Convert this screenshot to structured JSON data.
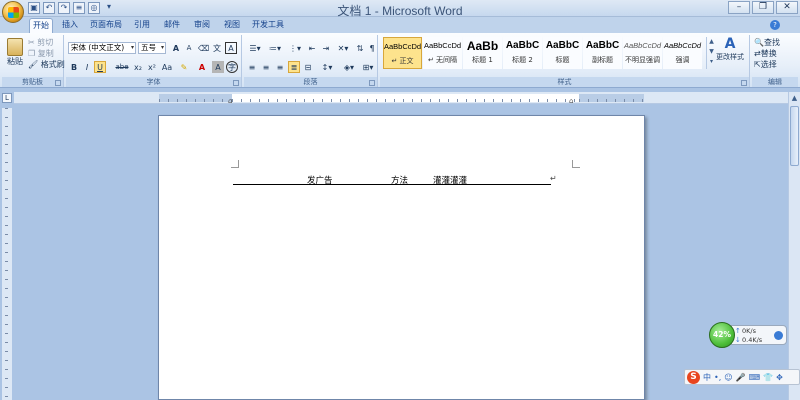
{
  "window": {
    "title": "文档 1 - Microsoft Word"
  },
  "qat": [
    "save",
    "undo",
    "redo",
    "format",
    "web",
    "more"
  ],
  "tabs": [
    "开始",
    "插入",
    "页面布局",
    "引用",
    "邮件",
    "审阅",
    "视图",
    "开发工具"
  ],
  "active_tab": "开始",
  "ribbon": {
    "clipboard": {
      "label": "剪贴板",
      "paste": "粘贴",
      "cut": "剪切",
      "copy": "复制",
      "format_painter": "格式刷"
    },
    "font": {
      "label": "字体",
      "font_name": "宋体 (中文正文)",
      "font_size": "五号",
      "buttons": [
        "B",
        "I",
        "U",
        "abe",
        "x₂",
        "x²",
        "Aa"
      ],
      "grow": "A",
      "shrink": "A",
      "clear": "A"
    },
    "paragraph": {
      "label": "段落"
    },
    "styles": {
      "label": "样式",
      "items": [
        {
          "sample": "AaBbCcDd",
          "name": "↵ 正文",
          "selected": true
        },
        {
          "sample": "AaBbCcDd",
          "name": "↵ 无间隔",
          "selected": false
        },
        {
          "sample": "AaBb",
          "name": "标题 1",
          "selected": false
        },
        {
          "sample": "AaBbC",
          "name": "标题 2",
          "selected": false
        },
        {
          "sample": "AaBbC",
          "name": "标题",
          "selected": false
        },
        {
          "sample": "AaBbC",
          "name": "副标题",
          "selected": false
        },
        {
          "sample": "AaBbCcDd",
          "name": "不明显强调",
          "selected": false
        },
        {
          "sample": "AaBbCcDd",
          "name": "强调",
          "selected": false
        }
      ],
      "change_styles": "更改样式"
    },
    "editing": {
      "label": "编辑",
      "find": "查找",
      "replace": "替换",
      "select": "选择"
    }
  },
  "document": {
    "words": [
      "发广告",
      "方法",
      "灌灌灌灌"
    ],
    "paragraph_mark": "↵"
  },
  "netmon": {
    "percent": "42%",
    "up": "0K/s",
    "down": "0.4K/s"
  },
  "ime": {
    "logo": "S",
    "mode": "中",
    "icons": [
      "punct-icon",
      "emoji-icon",
      "mic-icon",
      "keyboard-icon",
      "skin-icon",
      "tool-icon"
    ]
  },
  "colors": {
    "ribbon_bg": "#e7eff9",
    "accent": "#15428b",
    "style_selected": "#fde38d"
  }
}
